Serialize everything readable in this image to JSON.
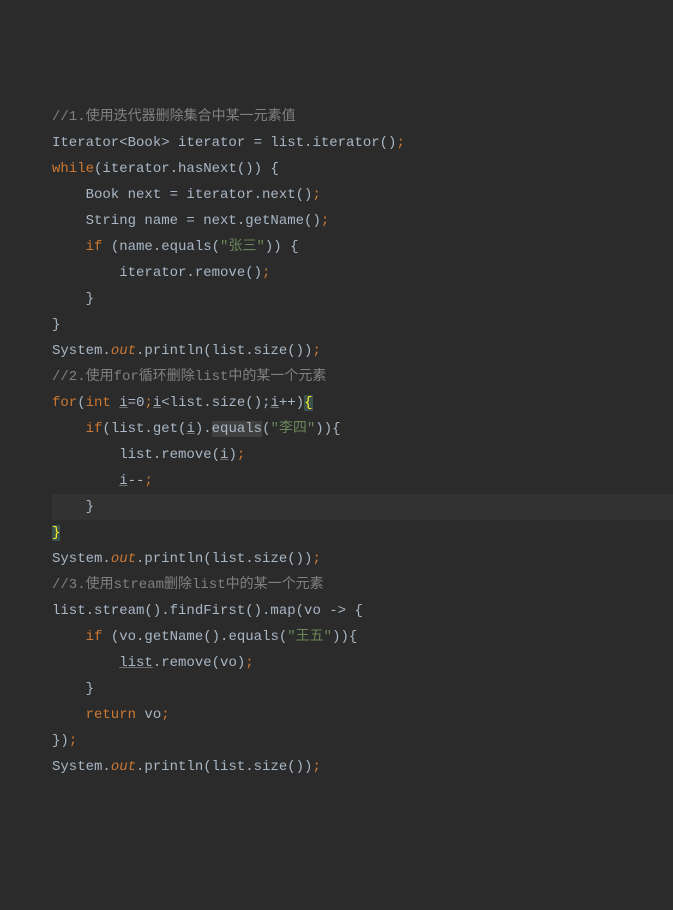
{
  "lines": {
    "l1_full": "//1.使用迭代器删除集合中某一元素值",
    "l2_pre": "Iterator<Book> iterator = list.iterator()",
    "l3_kw": "while",
    "l3_rest": "(iterator.hasNext()) {",
    "l4_pre": "    Book next = iterator.next()",
    "l5_pre": "    String name = next.getName()",
    "l6_if": "    if",
    "l6_mid": " (name.equals(",
    "l6_str": "\"张三\"",
    "l6_end": ")) {",
    "l7_pre": "        iterator.remove()",
    "l8": "    }",
    "l9": "}",
    "l10_a": "System.",
    "l10_out": "out",
    "l10_b": ".println(list.size())",
    "l11_full": "//2.使用for循环删除list中的某一个元素",
    "l12_for": "for",
    "l12_a": "(",
    "l12_int": "int",
    "l12_b": " ",
    "l12_i1": "i",
    "l12_c": "=",
    "l12_zero": "0",
    "l12_d": ";",
    "l12_i2": "i",
    "l12_e": "<list.size();",
    "l12_i3": "i",
    "l12_f": "++)",
    "l12_brace": "{",
    "l13_if": "    if",
    "l13_a": "(list.get(",
    "l13_i": "i",
    "l13_b": ").",
    "l13_eq": "equals",
    "l13_c": "(",
    "l13_str": "\"李四\"",
    "l13_d": ")){",
    "l14_a": "        list.remove(",
    "l14_i": "i",
    "l14_b": ")",
    "l15_a": "        ",
    "l15_i": "i",
    "l15_b": "--",
    "l16": "    }",
    "l17_brace": "}",
    "l18_a": "System.",
    "l18_out": "out",
    "l18_b": ".println(list.size())",
    "l19_full": "//3.使用stream删除list中的某一个元素",
    "l20_a": "list.stream().findFirst().map(vo -> {",
    "l21_if": "    if",
    "l21_a": " (vo.getName().equals(",
    "l21_str": "\"王五\"",
    "l21_b": ")){",
    "l22_a": "        ",
    "l22_list": "list",
    "l22_b": ".remove(vo)",
    "l23": "    }",
    "l24_kw": "    return",
    "l24_a": " vo",
    "l25_a": "})",
    "l26_a": "System.",
    "l26_out": "out",
    "l26_b": ".println(list.size())"
  }
}
